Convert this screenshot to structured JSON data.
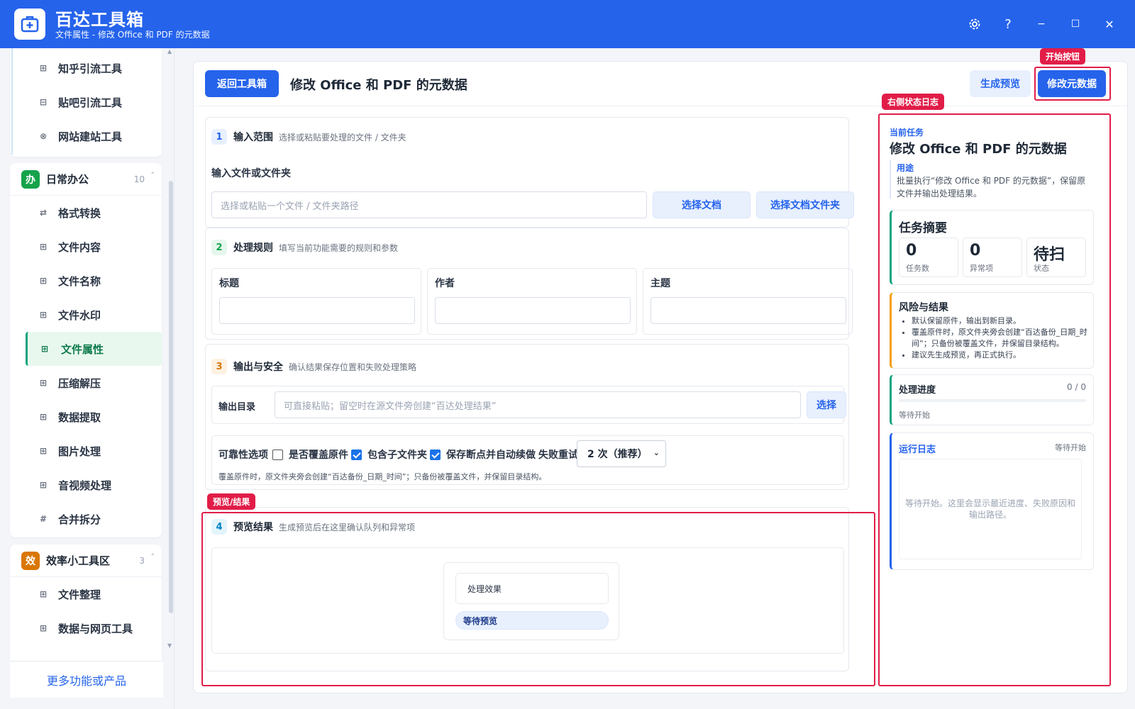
{
  "app": {
    "title": "百达工具箱",
    "subtitle": "文件属性 - 修改 Office 和 PDF 的元数据"
  },
  "window_controls": {
    "settings_icon": "gear-icon",
    "help": "?",
    "minimize": "−",
    "maximize": "☐",
    "close": "✕"
  },
  "sidebar": {
    "top_items": [
      {
        "label": "知乎引流工具",
        "icon": "⊞"
      },
      {
        "label": "贴吧引流工具",
        "icon": "⊟"
      },
      {
        "label": "网站建站工具",
        "icon": "⊗"
      }
    ],
    "group_office": {
      "badge": "办",
      "badge_color": "#16a34a",
      "title": "日常办公",
      "count": "10",
      "caret": "˄",
      "items": [
        {
          "label": "格式转换",
          "icon": "⇄"
        },
        {
          "label": "文件内容",
          "icon": "⊞"
        },
        {
          "label": "文件名称",
          "icon": "⊞"
        },
        {
          "label": "文件水印",
          "icon": "⊞"
        },
        {
          "label": "文件属性",
          "icon": "⊞",
          "active": true
        },
        {
          "label": "压缩解压",
          "icon": "⊞"
        },
        {
          "label": "数据提取",
          "icon": "⊞"
        },
        {
          "label": "图片处理",
          "icon": "⊞"
        },
        {
          "label": "音视频处理",
          "icon": "⊞"
        },
        {
          "label": "合并拆分",
          "icon": "#"
        }
      ]
    },
    "group_efficiency": {
      "badge": "效",
      "badge_color": "#d97706",
      "title": "效率小工具区",
      "count": "3",
      "caret": "˄",
      "items": [
        {
          "label": "文件整理",
          "icon": "⊞"
        },
        {
          "label": "数据与网页工具",
          "icon": "⊞"
        }
      ]
    },
    "more": "更多功能或产品"
  },
  "header": {
    "back": "返回工具箱",
    "title": "修改 Office 和 PDF 的元数据",
    "preview": "生成预览",
    "start": "修改元数据"
  },
  "sections": {
    "input": {
      "num": "1",
      "title": "输入范围",
      "desc": "选择或粘贴要处理的文件 / 文件夹",
      "field_label": "输入文件或文件夹",
      "placeholder": "选择或粘贴一个文件 / 文件夹路径",
      "btn_file": "选择文档",
      "btn_folder": "选择文档文件夹"
    },
    "rules": {
      "num": "2",
      "title": "处理规则",
      "desc": "填写当前功能需要的规则和参数",
      "fields": [
        "标题",
        "作者",
        "主题"
      ]
    },
    "output": {
      "num": "3",
      "title": "输出与安全",
      "desc": "确认结果保存位置和失败处理策略",
      "dir_label": "输出目录",
      "dir_placeholder": "可直接粘贴；留空时在源文件旁创建“百达处理结果”",
      "dir_button": "选择",
      "reliability_label": "可靠性选项",
      "opt_overwrite": "是否覆盖原件",
      "opt_overwrite_checked": false,
      "opt_subfolders": "包含子文件夹",
      "opt_subfolders_checked": true,
      "opt_resume": "保存断点并自动续做",
      "opt_resume_checked": true,
      "retry_label": "失败重试",
      "retry_value": "2 次（推荐）",
      "note": "覆盖原件时，原文件夹旁会创建“百达备份_日期_时间”；只备份被覆盖文件，并保留目录结构。"
    },
    "preview": {
      "num": "4",
      "title": "预览结果",
      "desc": "生成预览后在这里确认队列和异常项",
      "effect_label": "处理效果",
      "status": "等待预览"
    }
  },
  "annotations": {
    "start_button": "开始按钮",
    "right_log": "右侧状态日志",
    "preview_result": "预览/结果"
  },
  "right_panel": {
    "current_task_label": "当前任务",
    "task_title": "修改 Office 和 PDF 的元数据",
    "usage_label": "用途",
    "usage_text": "批量执行“修改 Office 和 PDF 的元数据”，保留原文件并输出处理结果。",
    "summary_title": "任务摘要",
    "stats": [
      {
        "value": "0",
        "label": "任务数"
      },
      {
        "value": "0",
        "label": "异常项"
      },
      {
        "value": "待扫",
        "label": "状态"
      }
    ],
    "risk_title": "风险与结果",
    "risk_items": [
      "默认保留原件，输出到新目录。",
      "覆盖原件时，原文件夹旁会创建“百达备份_日期_时间”；只备份被覆盖文件，并保留目录结构。",
      "建议先生成预览，再正式执行。"
    ],
    "progress_title": "处理进度",
    "progress_count": "0 / 0",
    "progress_fraction": 0,
    "progress_status": "等待开始",
    "log_title": "运行日志",
    "log_status": "等待开始",
    "log_placeholder": "等待开始。这里会显示最近进度、失败原因和输出路径。"
  },
  "colors": {
    "primary": "#2563eb",
    "annotation_red": "#e11d48",
    "success_green": "#10a37f",
    "warning_orange": "#f59e0b"
  }
}
